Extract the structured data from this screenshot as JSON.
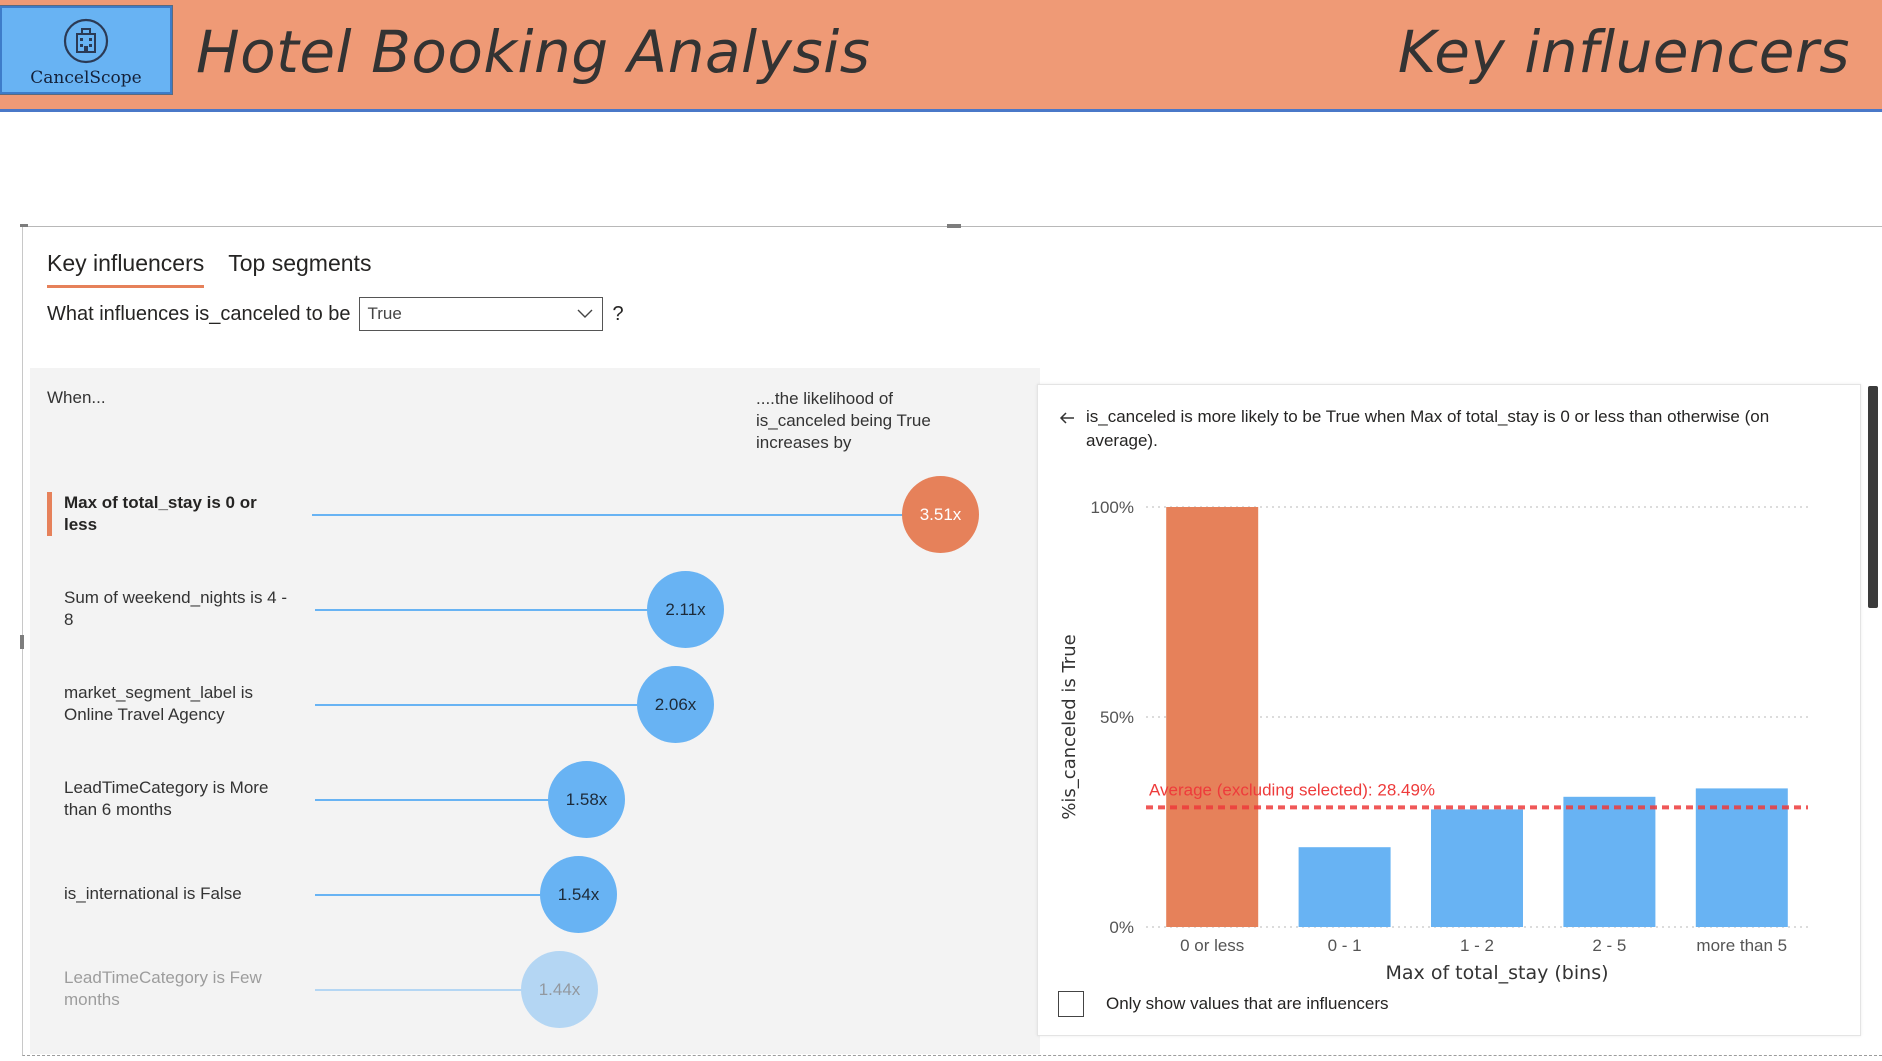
{
  "header": {
    "logo_text": "CancelScope",
    "app_title": "Hotel Booking Analysis",
    "page_title": "Key influencers"
  },
  "tabs": [
    {
      "label": "Key influencers",
      "active": true
    },
    {
      "label": "Top segments",
      "active": false
    }
  ],
  "question": {
    "prefix": "What influences is_canceled to be",
    "selected": "True",
    "suffix": "?"
  },
  "left_panel": {
    "when_label": "When...",
    "likelihood_label": "....the likelihood of is_canceled being True increases by",
    "influencers": [
      {
        "label": "Max of total_stay is 0 or less",
        "factor": "3.51x",
        "selected": true
      },
      {
        "label": "Sum of weekend_nights is 4 - 8",
        "factor": "2.11x",
        "selected": false
      },
      {
        "label": "market_segment_label is Online Travel Agency",
        "factor": "2.06x",
        "selected": false
      },
      {
        "label": "LeadTimeCategory is More than 6 months",
        "factor": "1.58x",
        "selected": false
      },
      {
        "label": "is_international is False",
        "factor": "1.54x",
        "selected": false
      },
      {
        "label": "LeadTimeCategory is Few months",
        "factor": "1.44x",
        "selected": false
      }
    ]
  },
  "detail": {
    "description": "is_canceled is more likely to be True when Max of total_stay is 0 or less than otherwise (on average).",
    "checkbox_label": "Only show values that are influencers",
    "checkbox_checked": false
  },
  "chart_data": {
    "type": "bar",
    "categories": [
      "0 or less",
      "0 - 1",
      "1 - 2",
      "2 - 5",
      "more than 5"
    ],
    "values": [
      100,
      19,
      28,
      31,
      33
    ],
    "highlighted_index": 0,
    "xlabel": "Max of total_stay (bins)",
    "ylabel": "%is_canceled is True",
    "ylim": [
      0,
      100
    ],
    "y_ticks": [
      "0%",
      "50%",
      "100%"
    ],
    "grid": true,
    "average_line": {
      "value": 28.49,
      "label": "Average (excluding selected): 28.49%"
    },
    "colors": {
      "highlight": "#E6815A",
      "bar": "#68B3F3",
      "average": "#EE3B3B"
    }
  },
  "colors": {
    "header_bg": "#EF9A76",
    "logo_bg": "#68B3F3",
    "accent": "#E6815A",
    "influencer_bubble": "#68B3F3"
  },
  "icons": [
    "building-icon",
    "filter-icon",
    "focus-mode-icon",
    "more-options-icon",
    "thumbs-up-icon",
    "thumbs-down-icon",
    "chevron-down-icon",
    "back-arrow-icon"
  ]
}
